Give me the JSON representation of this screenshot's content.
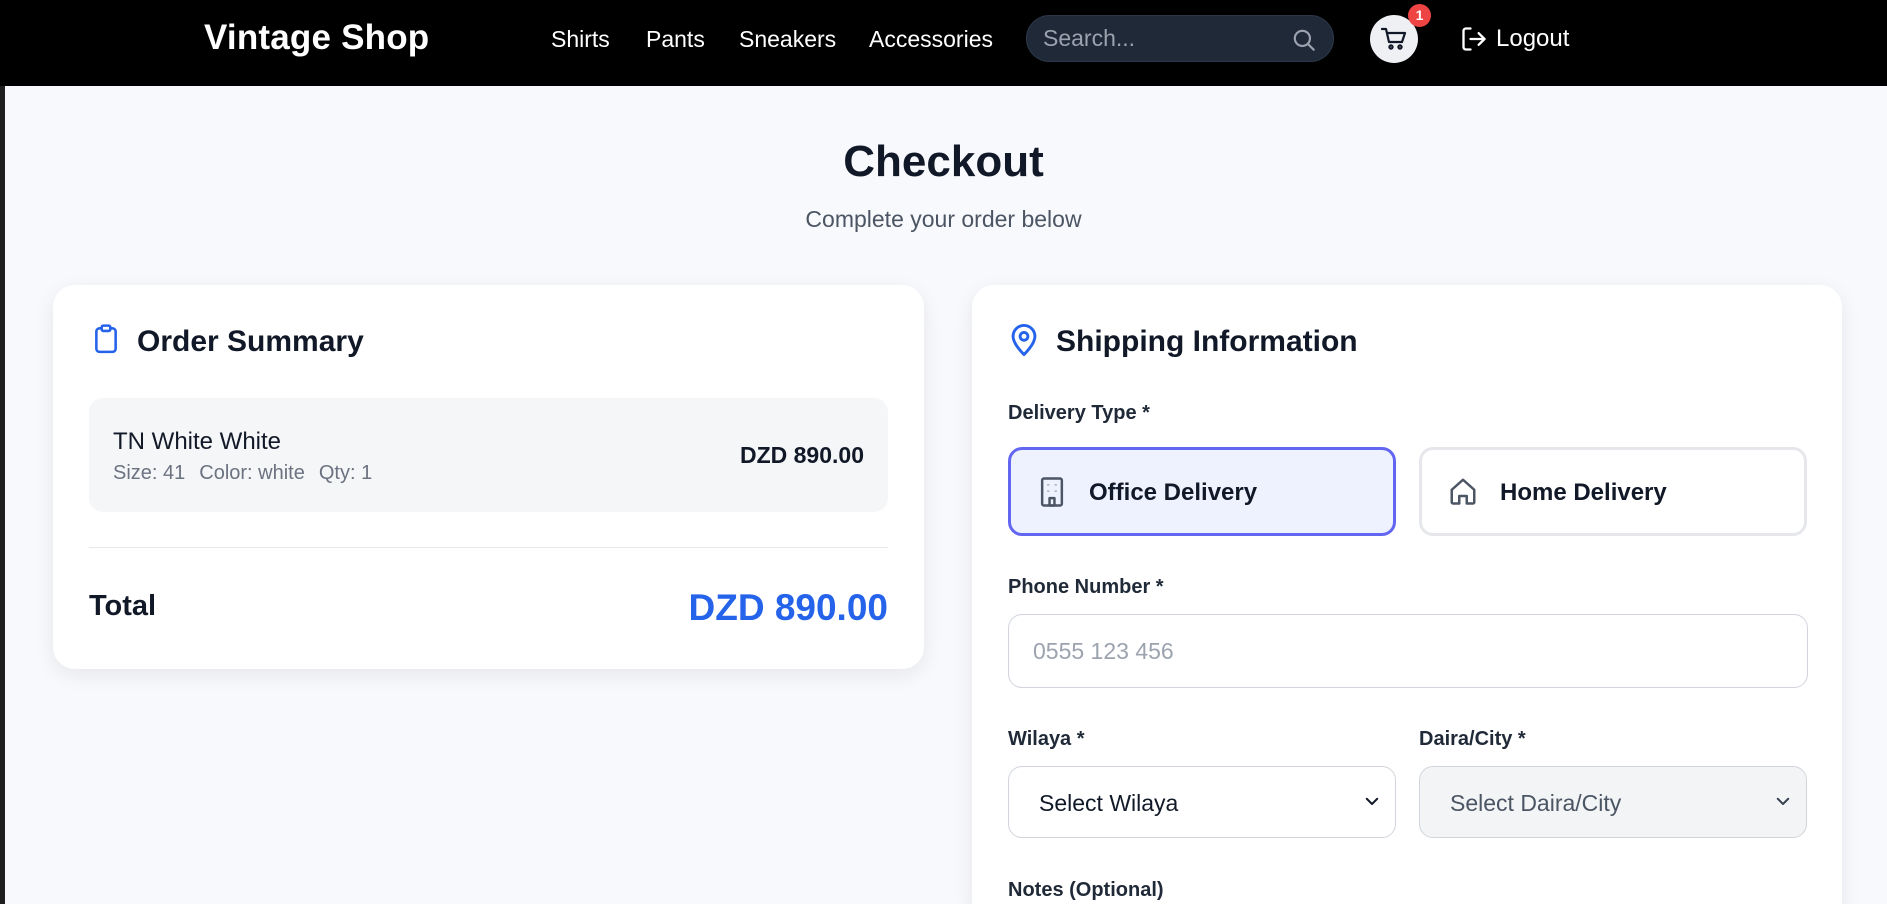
{
  "nav": {
    "brand": "Vintage Shop",
    "links": [
      "Shirts",
      "Pants",
      "Sneakers",
      "Accessories"
    ],
    "search_placeholder": "Search...",
    "cart_count": "1",
    "logout_label": "Logout"
  },
  "header": {
    "title": "Checkout",
    "subtitle": "Complete your order below"
  },
  "order_summary": {
    "title": "Order Summary",
    "item": {
      "name": "TN White White",
      "size": "Size: 41",
      "color": "Color: white",
      "qty": "Qty: 1",
      "price": "DZD 890.00"
    },
    "total_label": "Total",
    "total_value": "DZD 890.00"
  },
  "shipping": {
    "title": "Shipping Information",
    "delivery_type_label": "Delivery Type *",
    "options": [
      "Office Delivery",
      "Home Delivery"
    ],
    "selected_option": "Office Delivery",
    "phone_label": "Phone Number *",
    "phone_placeholder": "0555 123 456",
    "wilaya_label": "Wilaya *",
    "wilaya_value": "Select Wilaya",
    "daira_label": "Daira/City *",
    "daira_value": "Select Daira/City",
    "notes_label": "Notes (Optional)"
  },
  "colors": {
    "accent": "#2563eb",
    "selected_border": "#6366f1",
    "badge": "#ef4444",
    "navbar": "#000000"
  }
}
